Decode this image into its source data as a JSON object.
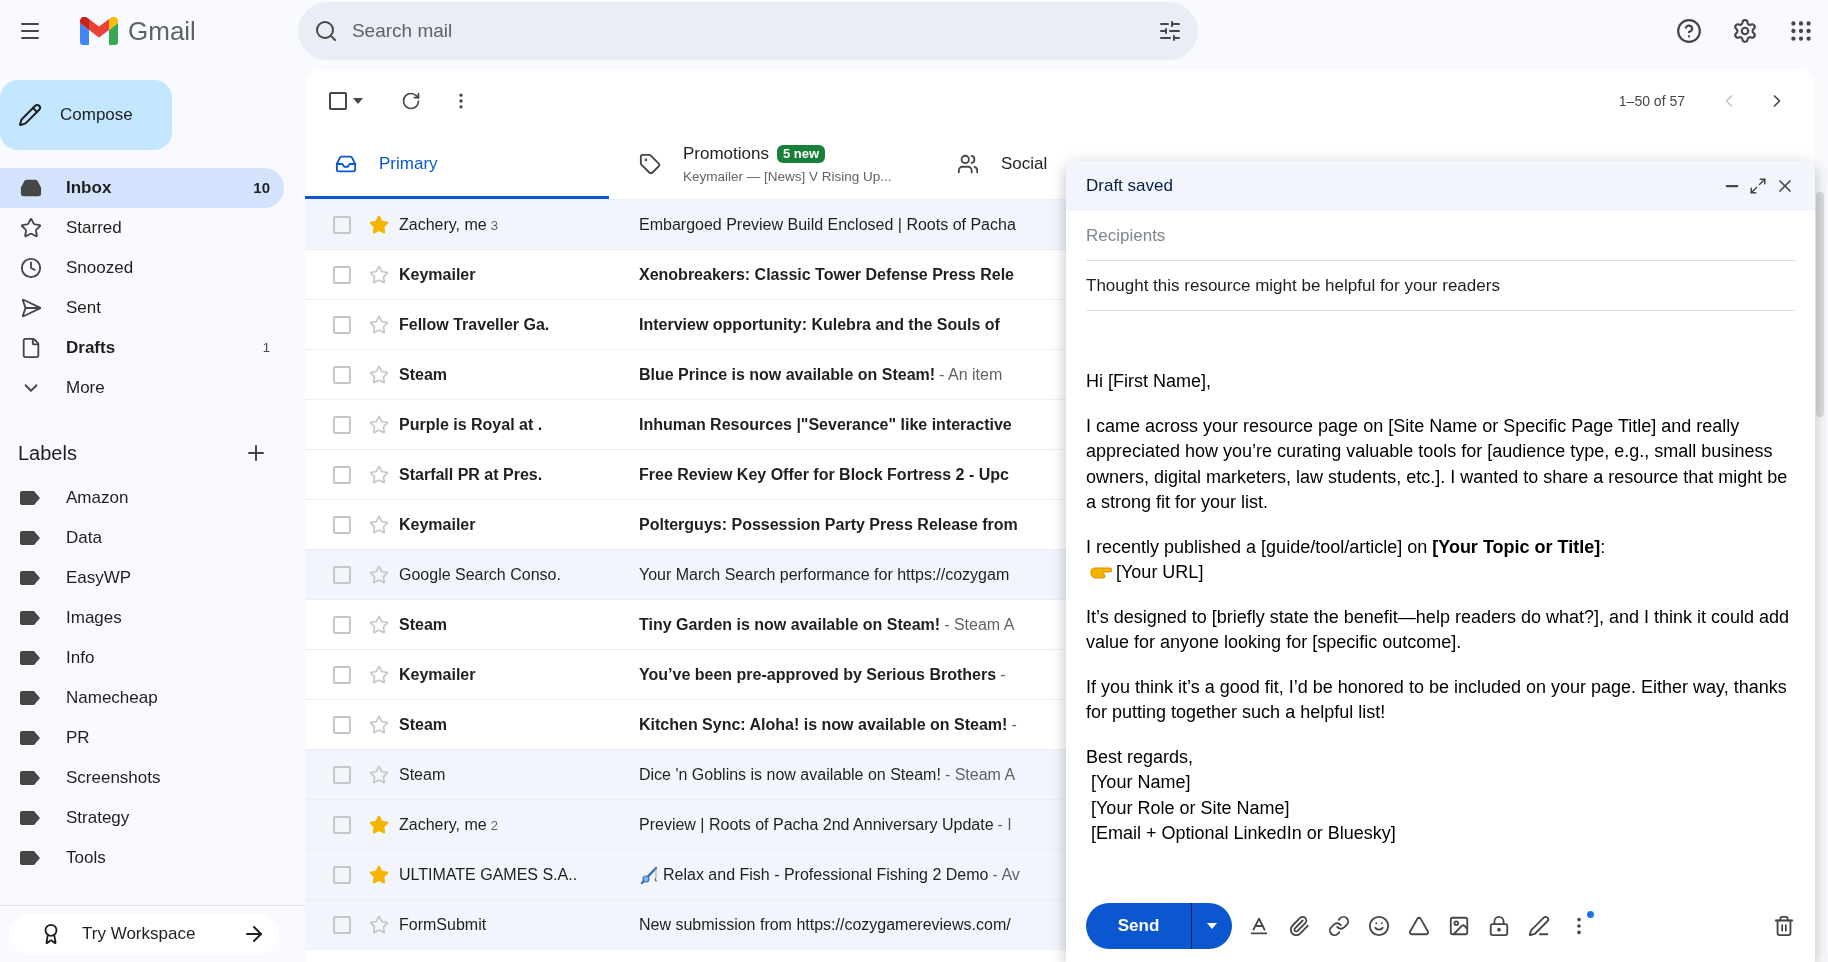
{
  "app": {
    "name": "Gmail"
  },
  "search": {
    "placeholder": "Search mail"
  },
  "compose_button": "Compose",
  "nav": [
    {
      "label": "Inbox",
      "count": "10",
      "selected": true,
      "unread": true
    },
    {
      "label": "Starred",
      "selected": false,
      "unread": false
    },
    {
      "label": "Snoozed",
      "selected": false,
      "unread": false
    },
    {
      "label": "Sent",
      "selected": false,
      "unread": false
    },
    {
      "label": "Drafts",
      "count": "1",
      "selected": false,
      "unread": true
    },
    {
      "label": "More",
      "selected": false,
      "unread": false
    }
  ],
  "labels": {
    "title": "Labels",
    "items": [
      "Amazon",
      "Data",
      "EasyWP",
      "Images",
      "Info",
      "Namecheap",
      "PR",
      "Screenshots",
      "Strategy",
      "Tools"
    ]
  },
  "workspace": "Try Workspace",
  "toolbar": {
    "select_all": {
      "checked": false
    },
    "range": "1–50 of 57"
  },
  "tabs": [
    {
      "label": "Primary",
      "selected": true
    },
    {
      "label": "Promotions",
      "badge": "5 new",
      "preview": "Keymailer — [News] V Rising Up...",
      "selected": false
    },
    {
      "label": "Social",
      "selected": false
    }
  ],
  "emails": [
    {
      "kind": "plain",
      "sender": "Zachery, me",
      "count": "3",
      "subject": "Embargoed Preview Build Enclosed | Roots of Pacha",
      "unread": false,
      "starred": true
    },
    {
      "kind": "plain",
      "sender": "Keymailer",
      "subject": "Xenobreakers: Classic Tower Defense Press Rele",
      "unread": true,
      "starred": false
    },
    {
      "kind": "plain",
      "sender": "Fellow Traveller Ga.",
      "subject": "Interview opportunity: Kulebra and the Souls of",
      "unread": true,
      "starred": false
    },
    {
      "kind": "plain",
      "sender": "Steam",
      "subject": "Blue Prince is now available on Steam!",
      "snippet": "- An item",
      "unread": true,
      "starred": false
    },
    {
      "kind": "plain",
      "sender": "Purple is Royal at .",
      "subject": "Inhuman Resources |\"Severance\" like interactive",
      "unread": true,
      "starred": false
    },
    {
      "kind": "plain",
      "sender": "Starfall PR at Pres.",
      "subject": "Free Review Key Offer for Block Fortress 2 - Upc",
      "unread": true,
      "starred": false
    },
    {
      "kind": "plain",
      "sender": "Keymailer",
      "subject": "Polterguys: Possession Party Press Release from",
      "unread": true,
      "starred": false
    },
    {
      "kind": "plain",
      "sender": "Google Search Conso.",
      "subject": "Your March Search performance for https://cozygam",
      "unread": false,
      "starred": false
    },
    {
      "kind": "plain",
      "sender": "Steam",
      "subject": "Tiny Garden is now available on Steam!",
      "snippet": "- Steam A",
      "unread": true,
      "starred": false
    },
    {
      "kind": "plain",
      "sender": "Keymailer",
      "subject": "You’ve been pre-approved by Serious Brothers",
      "snippet": "-",
      "unread": true,
      "starred": false
    },
    {
      "kind": "plain",
      "sender": "Steam",
      "subject": "Kitchen Sync: Aloha! is now available on Steam!",
      "snippet": "-",
      "unread": true,
      "starred": false
    },
    {
      "kind": "plain",
      "sender": "Steam",
      "subject": "Dice 'n Goblins is now available on Steam!",
      "snippet": "- Steam A",
      "unread": false,
      "starred": false
    },
    {
      "kind": "plain",
      "sender": "Zachery, me",
      "count": "2",
      "subject": "Preview | Roots of Pacha 2nd Anniversary Update",
      "snippet": "- I",
      "unread": false,
      "starred": true
    },
    {
      "kind": "emoji",
      "sender": "ULTIMATE GAMES S.A..",
      "subject": "Relax and Fish - Professional Fishing 2 Demo",
      "snippet": "- Av",
      "unread": false,
      "starred": true
    },
    {
      "kind": "plain",
      "sender": "FormSubmit",
      "subject": "New submission from https://cozygamereviews.com/",
      "unread": false,
      "starred": false
    }
  ],
  "compose": {
    "title": "Draft saved",
    "recipients": {
      "placeholder": "Recipients"
    },
    "subject": "Thought this resource might be helpful for your readers",
    "body": [
      {
        "lines": [
          {
            "kind": "text",
            "text": "Hi [First Name],"
          }
        ]
      },
      {
        "lines": [
          {
            "kind": "text",
            "text": "I came across your resource page on [Site Name or Specific Page Title] and really appreciated how you’re curating valuable tools for [audience type, e.g., small business owners, digital marketers, law students, etc.]. I wanted to share a resource that might be a strong fit for your list."
          }
        ]
      },
      {
        "lines": [
          {
            "kind": "text",
            "text": "I recently published a [guide/tool/article] on **[Your Topic or Title]**:"
          },
          {
            "kind": "pointer",
            "text": "[Your URL]"
          }
        ]
      },
      {
        "lines": [
          {
            "kind": "text",
            "text": "It’s designed to [briefly state the benefit—help readers do what?], and I think it could add value for anyone looking for [specific outcome]."
          }
        ]
      },
      {
        "lines": [
          {
            "kind": "text",
            "text": "If you think it’s a good fit, I’d be honored to be included on your page. Either way, thanks for putting together such a helpful list!"
          }
        ]
      },
      {
        "lines": [
          {
            "kind": "text",
            "text": "Best regards,"
          },
          {
            "kind": "text",
            "text": " [Your Name]"
          },
          {
            "kind": "text",
            "text": " [Your Role or Site Name]"
          },
          {
            "kind": "text",
            "text": " [Email + Optional LinkedIn or Bluesky]"
          }
        ]
      }
    ],
    "send": "Send"
  }
}
